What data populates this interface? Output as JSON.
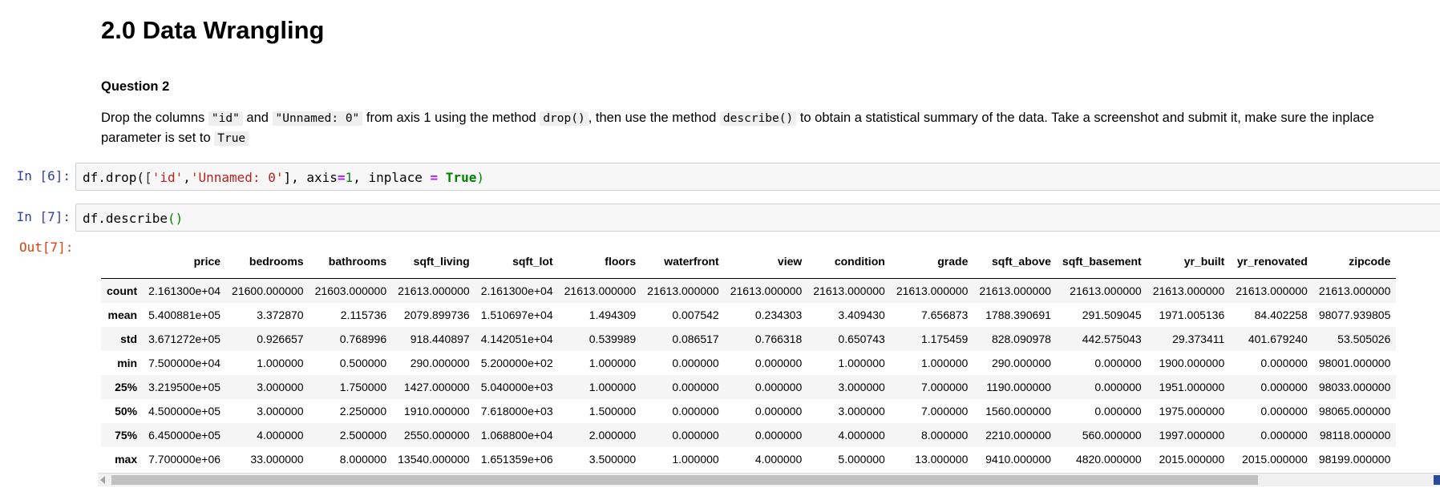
{
  "heading": "2.0 Data Wrangling",
  "question": "Question 2",
  "paragraph": {
    "p1": "Drop the columns ",
    "c1": "\"id\"",
    "p2": " and ",
    "c2": "\"Unnamed: 0\"",
    "p3": " from axis 1 using the method ",
    "c3": "drop()",
    "p4": ", then use the method ",
    "c4": "describe()",
    "p5": " to obtain a statistical summary of the data. Take a screenshot and submit it, make sure the inplace parameter is set to ",
    "c5": "True"
  },
  "cells": [
    {
      "prompt": "In [6]:"
    },
    {
      "prompt": "In [7]:",
      "out_prompt": "Out[7]:"
    }
  ],
  "code6": {
    "t1": "df.drop(",
    "t2": "[",
    "s1": "'id'",
    "t3": ",",
    "s2": "'Unnamed: 0'",
    "t4": "], axis",
    "op1": "=",
    "n1": "1",
    "t5": ", inplace ",
    "op2": "=",
    "t6": " ",
    "kw": "True",
    "t7": ")"
  },
  "code7": {
    "t1": "df.describe",
    "t2": "()"
  },
  "table": {
    "columns": [
      "price",
      "bedrooms",
      "bathrooms",
      "sqft_living",
      "sqft_lot",
      "floors",
      "waterfront",
      "view",
      "condition",
      "grade",
      "sqft_above",
      "sqft_basement",
      "yr_built",
      "yr_renovated",
      "zipcode"
    ],
    "rows": [
      {
        "label": "count",
        "values": [
          "2.161300e+04",
          "21600.000000",
          "21603.000000",
          "21613.000000",
          "2.161300e+04",
          "21613.000000",
          "21613.000000",
          "21613.000000",
          "21613.000000",
          "21613.000000",
          "21613.000000",
          "21613.000000",
          "21613.000000",
          "21613.000000",
          "21613.000000"
        ]
      },
      {
        "label": "mean",
        "values": [
          "5.400881e+05",
          "3.372870",
          "2.115736",
          "2079.899736",
          "1.510697e+04",
          "1.494309",
          "0.007542",
          "0.234303",
          "3.409430",
          "7.656873",
          "1788.390691",
          "291.509045",
          "1971.005136",
          "84.402258",
          "98077.939805"
        ]
      },
      {
        "label": "std",
        "values": [
          "3.671272e+05",
          "0.926657",
          "0.768996",
          "918.440897",
          "4.142051e+04",
          "0.539989",
          "0.086517",
          "0.766318",
          "0.650743",
          "1.175459",
          "828.090978",
          "442.575043",
          "29.373411",
          "401.679240",
          "53.505026"
        ]
      },
      {
        "label": "min",
        "values": [
          "7.500000e+04",
          "1.000000",
          "0.500000",
          "290.000000",
          "5.200000e+02",
          "1.000000",
          "0.000000",
          "0.000000",
          "1.000000",
          "1.000000",
          "290.000000",
          "0.000000",
          "1900.000000",
          "0.000000",
          "98001.000000"
        ]
      },
      {
        "label": "25%",
        "values": [
          "3.219500e+05",
          "3.000000",
          "1.750000",
          "1427.000000",
          "5.040000e+03",
          "1.000000",
          "0.000000",
          "0.000000",
          "3.000000",
          "7.000000",
          "1190.000000",
          "0.000000",
          "1951.000000",
          "0.000000",
          "98033.000000"
        ]
      },
      {
        "label": "50%",
        "values": [
          "4.500000e+05",
          "3.000000",
          "2.250000",
          "1910.000000",
          "7.618000e+03",
          "1.500000",
          "0.000000",
          "0.000000",
          "3.000000",
          "7.000000",
          "1560.000000",
          "0.000000",
          "1975.000000",
          "0.000000",
          "98065.000000"
        ]
      },
      {
        "label": "75%",
        "values": [
          "6.450000e+05",
          "4.000000",
          "2.500000",
          "2550.000000",
          "1.068800e+04",
          "2.000000",
          "0.000000",
          "0.000000",
          "4.000000",
          "8.000000",
          "2210.000000",
          "560.000000",
          "1997.000000",
          "0.000000",
          "98118.000000"
        ]
      },
      {
        "label": "max",
        "values": [
          "7.700000e+06",
          "33.000000",
          "8.000000",
          "13540.000000",
          "1.651359e+06",
          "3.500000",
          "1.000000",
          "4.000000",
          "5.000000",
          "13.000000",
          "9410.000000",
          "4820.000000",
          "2015.000000",
          "2015.000000",
          "98199.000000"
        ]
      }
    ]
  },
  "colors": {
    "in_prompt": "#303f9f",
    "out_prompt": "#d84315",
    "string": "#ba2121",
    "number": "#008800",
    "keyword": "#008000",
    "operator": "#aa22ff"
  }
}
